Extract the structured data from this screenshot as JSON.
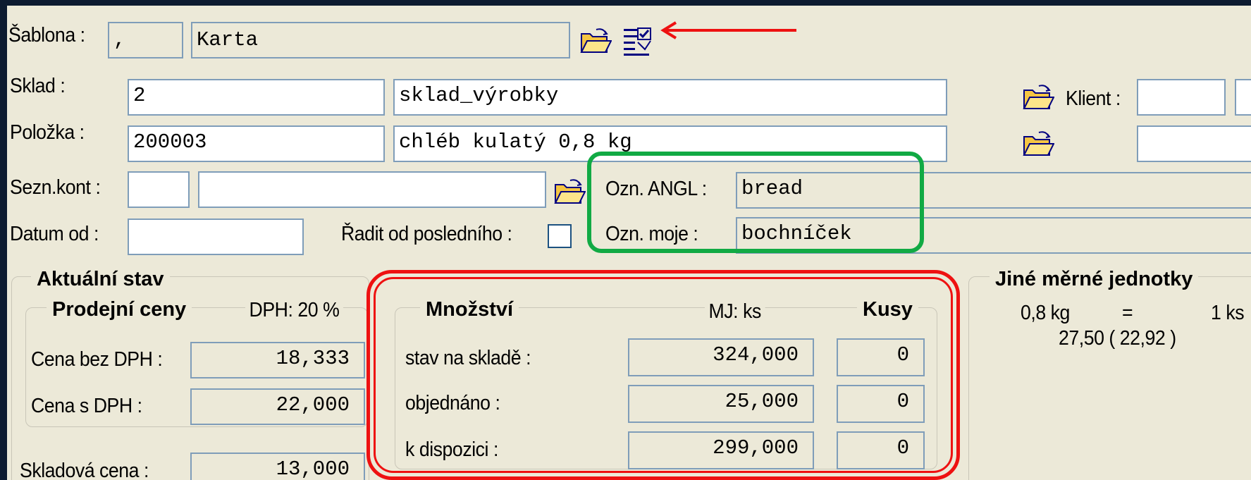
{
  "template": {
    "label": "Šablona :",
    "code": ",",
    "name": "Karta"
  },
  "warehouse": {
    "label": "Sklad :",
    "code": "2",
    "name": "sklad_výrobky"
  },
  "client": {
    "label": "Klient :"
  },
  "item": {
    "label": "Položka :",
    "code": "200003",
    "name": "chléb kulatý 0,8 kg"
  },
  "contacts": {
    "label": "Sezn.kont :"
  },
  "date_from": {
    "label": "Datum od :"
  },
  "sort_last": {
    "label": "Řadit od posledního :",
    "checked": false
  },
  "designation": {
    "angl_label": "Ozn. ANGL :",
    "angl_value": "bread",
    "mine_label": "Ozn. moje :",
    "mine_value": "bochníček"
  },
  "current_state": {
    "title": "Aktuální stav",
    "prices": {
      "title": "Prodejní ceny",
      "vat": "DPH: 20 %",
      "price_no_vat_label": "Cena bez DPH :",
      "price_no_vat": "18,333",
      "price_vat_label": "Cena s DPH :",
      "price_vat": "22,000"
    },
    "stock_price_label": "Skladová cena :",
    "stock_price": "13,000"
  },
  "quantity": {
    "title": "Množství",
    "unit": "MJ: ks",
    "pieces": "Kusy",
    "rows": [
      {
        "label": "stav na skladě :",
        "value": "324,000",
        "pieces": "0"
      },
      {
        "label": "objednáno :",
        "value": "25,000",
        "pieces": "0"
      },
      {
        "label": "k dispozici :",
        "value": "299,000",
        "pieces": "0"
      }
    ]
  },
  "other_units": {
    "title": "Jiné měrné jednotky",
    "line1_left": "0,8 kg",
    "line1_eq": "=",
    "line1_right": "1 ks",
    "line2": "27,50 ( 22,92 )"
  },
  "colors": {
    "window_bg": "#ece9d8",
    "frame": "#0d1b30",
    "field_border": "#7f9db9",
    "red_highlight": "#ee1111",
    "green_highlight": "#11aa44"
  },
  "icons": [
    "folder-open-icon",
    "list-check-icon"
  ]
}
